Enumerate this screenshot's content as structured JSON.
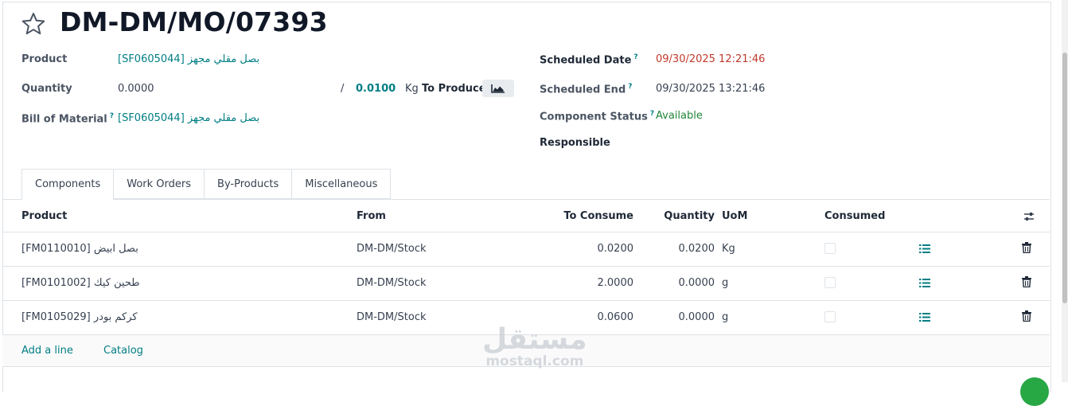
{
  "record": {
    "title": "DM-DM/MO/07393"
  },
  "fields": {
    "product_label": "Product",
    "product_value": "[SF0605044] بصل مقلي مجهز",
    "quantity_label": "Quantity",
    "quantity_value": "0.0000",
    "quantity_sep": "/",
    "quantity_target": "0.0100",
    "quantity_uom": "Kg",
    "to_produce_label": "To Produce",
    "bom_label": "Bill of Material",
    "bom_value": "[SF0605044] بصل مقلي مجهز",
    "scheduled_date_label": "Scheduled Date",
    "scheduled_date_value": "09/30/2025 12:21:46",
    "scheduled_end_label": "Scheduled End",
    "scheduled_end_value": "09/30/2025 13:21:46",
    "component_status_label": "Component Status",
    "component_status_value": "Available",
    "responsible_label": "Responsible",
    "help_mark": "?"
  },
  "tabs": [
    {
      "label": "Components"
    },
    {
      "label": "Work Orders"
    },
    {
      "label": "By-Products"
    },
    {
      "label": "Miscellaneous"
    }
  ],
  "table": {
    "headers": {
      "product": "Product",
      "from": "From",
      "to_consume": "To Consume",
      "quantity": "Quantity",
      "uom": "UoM",
      "consumed": "Consumed"
    },
    "rows": [
      {
        "product": "[FM0110010] بصل ابيض",
        "from": "DM-DM/Stock",
        "to_consume": "0.0200",
        "quantity": "0.0200",
        "uom": "Kg"
      },
      {
        "product": "[FM0101002] طحين كيك",
        "from": "DM-DM/Stock",
        "to_consume": "2.0000",
        "quantity": "0.0000",
        "uom": "g"
      },
      {
        "product": "[FM0105029] كركم بودر",
        "from": "DM-DM/Stock",
        "to_consume": "0.0600",
        "quantity": "0.0000",
        "uom": "g"
      }
    ],
    "add_line": "Add a line",
    "catalog": "Catalog"
  },
  "watermark": {
    "arabic": "مستقل",
    "latin": "mostaql.com"
  },
  "colors": {
    "link": "#017e84",
    "date_red": "#c0392b",
    "available_green": "#22863a"
  }
}
